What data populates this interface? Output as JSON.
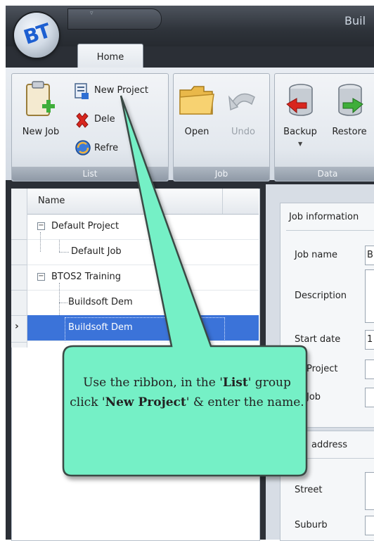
{
  "app": {
    "title": "Buil",
    "logo_text": "BT"
  },
  "tabs": [
    {
      "label": "Home"
    }
  ],
  "ribbon": {
    "list_group": {
      "label": "List",
      "new_job": "New Job",
      "new_project": "New Project",
      "delete": "Dele",
      "refresh": "Refre"
    },
    "job_group": {
      "label": "Job",
      "open": "Open",
      "undo": "Undo"
    },
    "data_group": {
      "label": "Data",
      "backup": "Backup",
      "restore": "Restore"
    }
  },
  "tree": {
    "column_header": "Name",
    "rows": [
      {
        "label": "Default Project"
      },
      {
        "label": "Default Job"
      },
      {
        "label": "BTOS2 Training"
      },
      {
        "label": "Buildsoft Dem"
      },
      {
        "label": "Buildsoft Dem"
      }
    ]
  },
  "job_information": {
    "section_title": "Job information",
    "job_name_label": "Job name",
    "job_name_value": "B",
    "description_label": "Description",
    "start_date_label": "Start date",
    "start_date_value": "1",
    "project_label": "W Project",
    "job_label": "W Job"
  },
  "address": {
    "section_title": "address",
    "street_label": "Street",
    "suburb_label": "Suburb"
  },
  "callout": {
    "part1": "Use the ribbon, in the '",
    "bold1": "List",
    "part2": "' group click '",
    "bold2": "New Project",
    "part3": "' & enter the name."
  },
  "colors": {
    "callout_fill": "#74f0c6",
    "selection": "#3b73d9",
    "title_text": "#cfd8e3"
  },
  "icons": {
    "new_job": "clipboard-plus-icon",
    "new_project": "project-document-icon",
    "delete": "red-x-icon",
    "refresh": "refresh-globe-icon",
    "open": "folder-icon",
    "undo": "undo-arrow-icon",
    "backup": "database-backup-icon",
    "restore": "database-restore-icon"
  }
}
